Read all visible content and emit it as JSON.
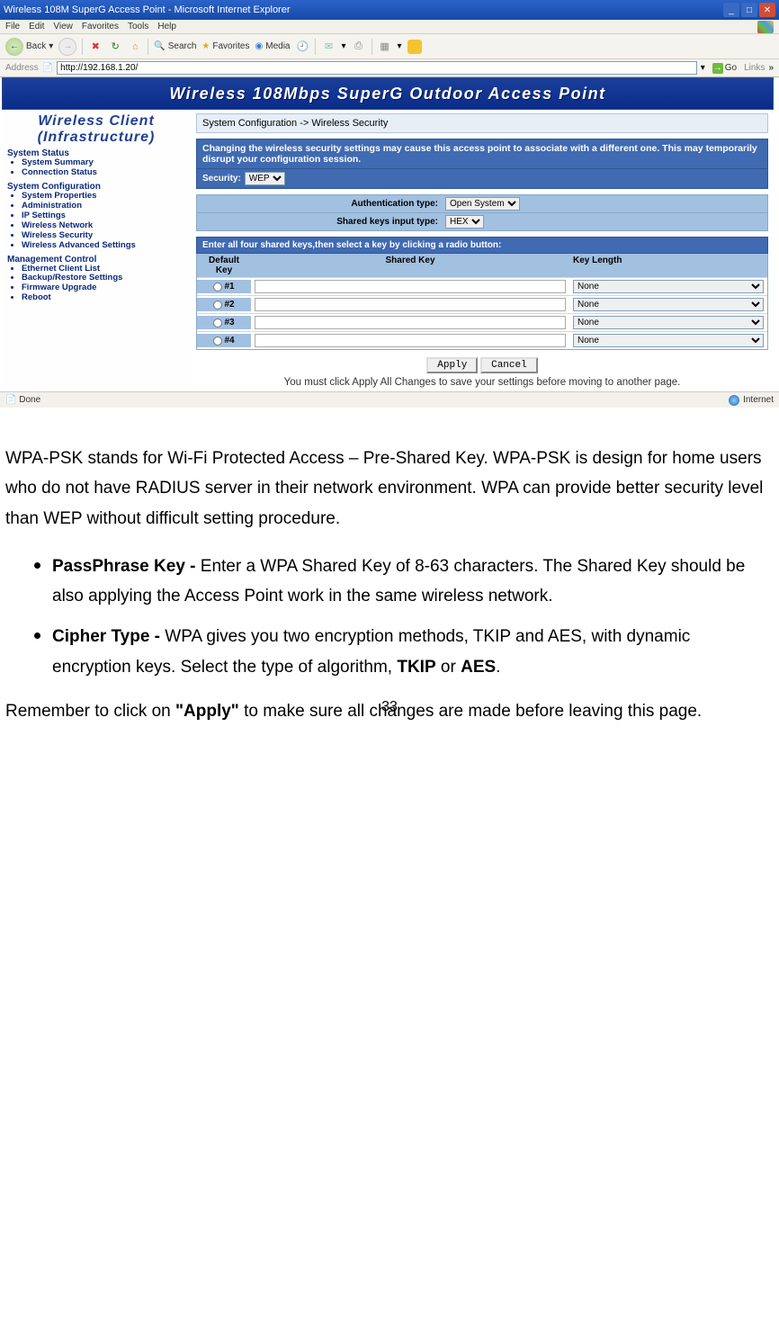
{
  "titlebar": {
    "title": "Wireless 108M SuperG Access Point - Microsoft Internet Explorer"
  },
  "menubar": {
    "items": [
      "File",
      "Edit",
      "View",
      "Favorites",
      "Tools",
      "Help"
    ]
  },
  "toolbar": {
    "back": "Back",
    "search": "Search",
    "favorites": "Favorites",
    "media": "Media"
  },
  "addrbar": {
    "label": "Address",
    "url": "http://192.168.1.20/",
    "go": "Go",
    "links": "Links"
  },
  "banner": "Wireless 108Mbps SuperG Outdoor Access Point",
  "sidebar": {
    "title1": "Wireless Client",
    "title2": "(Infrastructure)",
    "sections": [
      {
        "head": "System Status",
        "items": [
          "System Summary",
          "Connection Status"
        ]
      },
      {
        "head": "System Configuration",
        "items": [
          "System Properties",
          "Administration",
          "IP Settings",
          "Wireless Network",
          "Wireless Security",
          "Wireless Advanced Settings"
        ]
      },
      {
        "head": "Management Control",
        "items": [
          "Ethernet Client List",
          "Backup/Restore Settings",
          "Firmware Upgrade",
          "Reboot"
        ]
      }
    ]
  },
  "main": {
    "breadcrumb": "System Configuration -> Wireless Security",
    "warning": "Changing the wireless security settings may cause this access point to associate with a different one. This may temporarily disrupt your configuration session.",
    "security_label": "Security:",
    "security_value": "WEP",
    "auth_label": "Authentication type:",
    "auth_value": "Open System",
    "input_label": "Shared keys input type:",
    "input_value": "HEX",
    "table_title": "Enter all four shared keys,then select a key by clicking a radio button:",
    "col1": "Default Key",
    "col2": "Shared Key",
    "col3": "Key Length",
    "rows": [
      {
        "id": "#1",
        "len": "None"
      },
      {
        "id": "#2",
        "len": "None"
      },
      {
        "id": "#3",
        "len": "None"
      },
      {
        "id": "#4",
        "len": "None"
      }
    ],
    "apply": "Apply",
    "cancel": "Cancel",
    "note": "You must click Apply All Changes to save your settings before moving to another page."
  },
  "statusbar": {
    "left": "Done",
    "right": "Internet"
  },
  "doc": {
    "p1": "WPA-PSK stands for Wi-Fi Protected Access – Pre-Shared Key. WPA-PSK is design for home users who do not have RADIUS server in their network environment. WPA can provide better security level than WEP without difficult setting procedure.",
    "b1_strong": "PassPhrase Key - ",
    "b1_text": "Enter a WPA Shared Key of 8-63 characters. The Shared Key should be also applying the Access Point work in the same wireless network.",
    "b2_strong": "Cipher Type - ",
    "b2_text_a": "WPA gives you two encryption methods, TKIP and AES, with dynamic encryption keys. Select the type of algorithm, ",
    "b2_tkip": "TKIP",
    "b2_or": " or ",
    "b2_aes": "AES",
    "p2_a": "Remember to click on ",
    "p2_b": "\"Apply\"",
    "p2_c": " to make sure all changes are made before leaving this page."
  },
  "page_number": "33"
}
